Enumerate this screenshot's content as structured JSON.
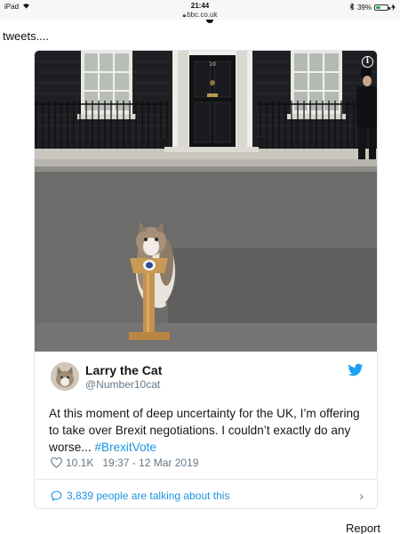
{
  "status_bar": {
    "device": "iPad",
    "time": "21:44",
    "url": "bbc.co.uk",
    "battery": "39%",
    "battery_level": 0.39,
    "icons": [
      "wifi-icon",
      "lock-icon",
      "bluetooth-icon",
      "battery-icon",
      "charging-icon"
    ]
  },
  "intro_text": "tweets....",
  "tweet": {
    "image": {
      "door_number": "10",
      "info_label": "i"
    },
    "author_name": "Larry the Cat",
    "author_handle": "@Number10cat",
    "text_before": "At this moment of deep uncertainty for the UK, I’m offering to take over Brexit negotiations. I couldn’t exactly do any worse... ",
    "hashtag": "#BrexitVote",
    "likes": "10.1K",
    "timestamp": "19:37 - 12 Mar 2019",
    "conversation": "3,839 people are talking about this",
    "chevron": "›",
    "colors": {
      "link": "#1b95e0",
      "muted": "#657786",
      "border": "#e1e8ed"
    }
  },
  "report_label": "Report"
}
